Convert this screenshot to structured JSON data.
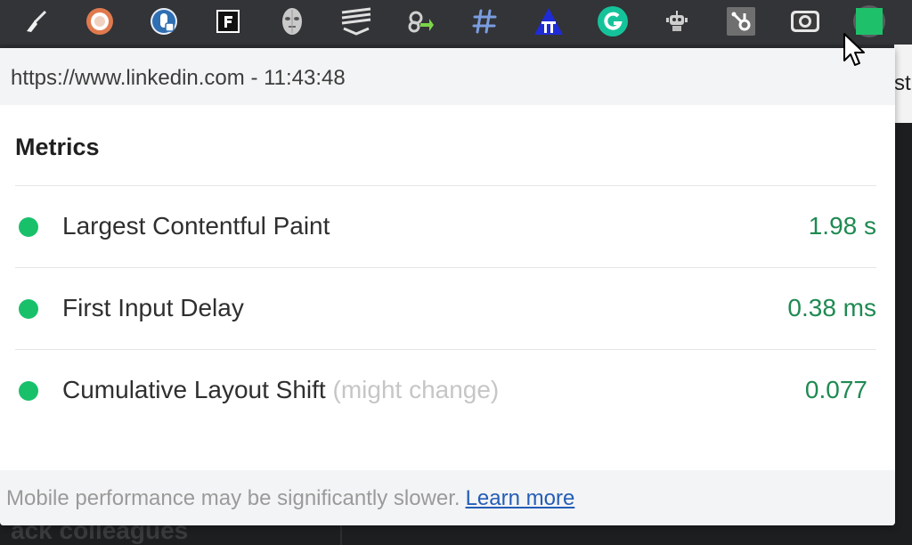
{
  "popup": {
    "header": "https://www.linkedin.com - 11:43:48",
    "section_title": "Metrics",
    "metrics": [
      {
        "name": "Largest Contentful Paint",
        "note": "",
        "value": "1.98 s",
        "status_color": "#19c06a"
      },
      {
        "name": "First Input Delay",
        "note": "",
        "value": "0.38 ms",
        "status_color": "#19c06a"
      },
      {
        "name": "Cumulative Layout Shift",
        "note": "(might change)",
        "value": "0.077",
        "status_color": "#19c06a"
      }
    ],
    "footer": {
      "text": "Mobile performance may be significantly slower.",
      "link": "Learn more"
    }
  },
  "toolbar": {
    "extensions": [
      "broom-icon",
      "circle-ring-icon",
      "key-lock-icon",
      "f-letter-icon",
      "face-mask-icon",
      "stacked-lines-icon",
      "puzzle-arrow-icon",
      "hashtag-icon",
      "pi-triangle-icon",
      "grammarly-g-icon",
      "robot-icon",
      "hubspot-icon",
      "camera-icon",
      "web-vitals-square-icon"
    ]
  },
  "background": {
    "peek_right": "st",
    "peek_bottom": "ack colleagues"
  }
}
